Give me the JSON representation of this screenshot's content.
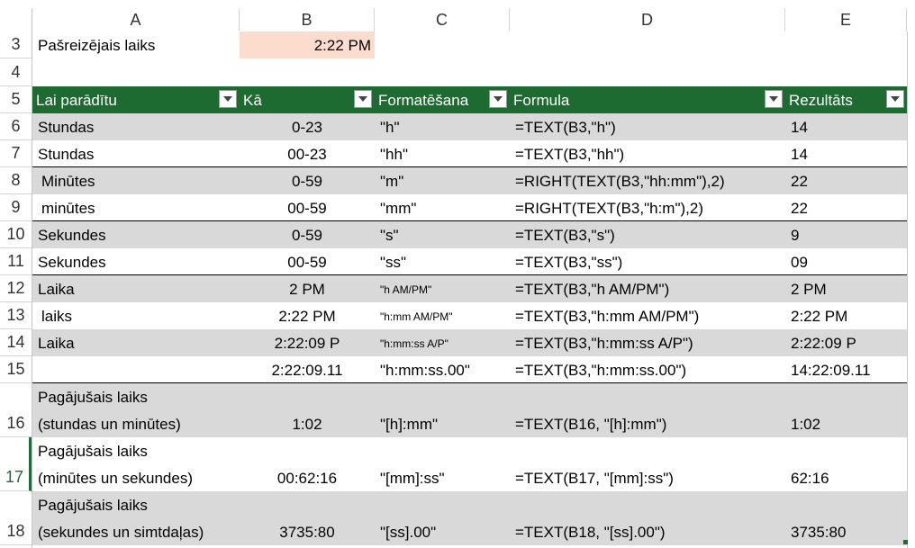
{
  "column_headers": [
    "A",
    "B",
    "C",
    "D",
    "E"
  ],
  "row_numbers": [
    "3",
    "4",
    "5",
    "6",
    "7",
    "8",
    "9",
    "10",
    "11",
    "12",
    "13",
    "14",
    "15",
    "16",
    "17",
    "18"
  ],
  "row3": {
    "label": "Pašreizējais laiks",
    "value": "2:22 PM"
  },
  "table_headers": [
    "Lai parādītu",
    "Kā",
    "Formatēšana",
    "Formula",
    "Rezultāts"
  ],
  "rows": [
    {
      "a": "Stundas",
      "b": "0-23",
      "c": "\"h\"",
      "d": "=TEXT(B3,\"h\")",
      "e": "14"
    },
    {
      "a": "Stundas",
      "b": "00-23",
      "c": "\"hh\"",
      "d": "=TEXT(B3,\"hh\")",
      "e": "14"
    },
    {
      "a": "Minūtes",
      "b": "0-59",
      "c": "\"m\"",
      "d": "=RIGHT(TEXT(B3,\"hh:mm\"),2)",
      "e": "22"
    },
    {
      "a": "minūtes",
      "b": "00-59",
      "c": "\"mm\"",
      "d": "=RIGHT(TEXT(B3,\"h:m\"),2)",
      "e": "22"
    },
    {
      "a": "Sekundes",
      "b": "0-59",
      "c": "\"s\"",
      "d": "=TEXT(B3,\"s\")",
      "e": "9"
    },
    {
      "a": "Sekundes",
      "b": "00-59",
      "c": "\"ss\"",
      "d": "=TEXT(B3,\"ss\")",
      "e": "09"
    },
    {
      "a": "Laika",
      "b": "2 PM",
      "c": "\"h AM/PM\"",
      "d": "=TEXT(B3,\"h AM/PM\")",
      "e": "2 PM"
    },
    {
      "a": "laiks",
      "b": "2:22 PM",
      "c": "\"h:mm AM/PM\"",
      "d": "=TEXT(B3,\"h:mm AM/PM\")",
      "e": "2:22 PM"
    },
    {
      "a": "Laika",
      "b": "2:22:09 P",
      "c": "\"h:mm:ss A/P\"",
      "d": "=TEXT(B3,\"h:mm:ss A/P\")",
      "e": "2:22:09 P"
    },
    {
      "a": "",
      "b": "2:22:09.11",
      "c": "\"h:mm:ss.00\"",
      "d": "=TEXT(B3,\"h:mm:ss.00\")",
      "e": "14:22:09.11"
    }
  ],
  "tall_rows": [
    {
      "a1": "Pagājušais laiks",
      "a2": "(stundas un minūtes)",
      "b": "1:02",
      "c": "\"[h]:mm\"",
      "d": "=TEXT(B16, \"[h]:mm\")",
      "e": "1:02"
    },
    {
      "a1": "Pagājušais laiks",
      "a2": "(minūtes un sekundes)",
      "b": "00:62:16",
      "c": "\"[mm]:ss\"",
      "d": "=TEXT(B17, \"[mm]:ss\")",
      "e": "62:16"
    },
    {
      "a1": "Pagājušais laiks",
      "a2": "(sekundes un simtdaļas)",
      "b": "3735:80",
      "c": "\"[ss].00\"",
      "d": "=TEXT(B18, \"[ss].00\")",
      "e": "3735:80"
    }
  ],
  "colors": {
    "header_green": "#1e6b32",
    "band_grey": "#d9d9d9",
    "highlight_b3": "#fcdccc",
    "selected_row": "#1e6b3a"
  }
}
